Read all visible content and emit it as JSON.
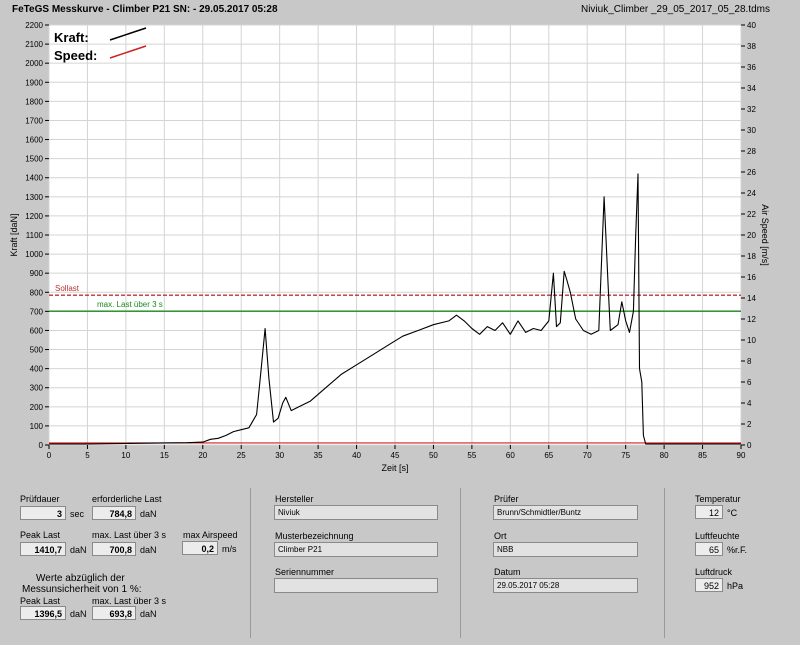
{
  "header": {
    "title": "FeTeGS Messkurve - Climber P21   SN:   - 29.05.2017 05:28",
    "file": "Niviuk_Climber _29_05_2017_05_28.tdms"
  },
  "chart_data": {
    "type": "line",
    "xlabel": "Zeit [s]",
    "ylabel": "Kraft [daN]",
    "y2label": "Air Speed [m/s]",
    "xlim": [
      0,
      90
    ],
    "ylim": [
      0,
      2200
    ],
    "y2lim": [
      0,
      40
    ],
    "xticks": [
      0,
      5,
      10,
      15,
      20,
      25,
      30,
      35,
      40,
      45,
      50,
      55,
      60,
      65,
      70,
      75,
      80,
      85,
      90
    ],
    "yticks": [
      0,
      100,
      200,
      300,
      400,
      500,
      600,
      700,
      800,
      900,
      1000,
      1100,
      1200,
      1300,
      1400,
      1500,
      1600,
      1700,
      1800,
      1900,
      2000,
      2100,
      2200
    ],
    "y2ticks": [
      0,
      2,
      4,
      6,
      8,
      10,
      12,
      14,
      16,
      18,
      20,
      22,
      24,
      26,
      28,
      30,
      32,
      34,
      36,
      38,
      40
    ],
    "grid": true,
    "legend": {
      "position": "top-left",
      "items": [
        {
          "name": "Kraft:",
          "color": "#000000"
        },
        {
          "name": "Speed:",
          "color": "#d02020"
        }
      ]
    },
    "reference_lines": [
      {
        "name": "Sollast",
        "value": 784.8,
        "color": "#c03030",
        "style": "dashed"
      },
      {
        "name": "max. Last über  3 s",
        "value": 700.8,
        "color": "#1a8a1a",
        "style": "solid"
      }
    ],
    "series": [
      {
        "name": "Kraft",
        "color": "#000000",
        "points": [
          [
            0,
            5
          ],
          [
            5,
            5
          ],
          [
            10,
            8
          ],
          [
            14,
            10
          ],
          [
            18,
            12
          ],
          [
            20,
            15
          ],
          [
            21,
            30
          ],
          [
            22,
            35
          ],
          [
            23,
            50
          ],
          [
            24,
            70
          ],
          [
            25,
            80
          ],
          [
            26,
            90
          ],
          [
            27,
            160
          ],
          [
            27.6,
            400
          ],
          [
            28.1,
            610
          ],
          [
            28.6,
            350
          ],
          [
            29.2,
            120
          ],
          [
            29.8,
            140
          ],
          [
            30.4,
            220
          ],
          [
            30.8,
            250
          ],
          [
            31.5,
            180
          ],
          [
            32.5,
            200
          ],
          [
            34,
            230
          ],
          [
            36,
            300
          ],
          [
            38,
            370
          ],
          [
            40,
            420
          ],
          [
            42,
            470
          ],
          [
            44,
            520
          ],
          [
            46,
            570
          ],
          [
            48,
            600
          ],
          [
            50,
            630
          ],
          [
            52,
            650
          ],
          [
            53,
            680
          ],
          [
            54,
            650
          ],
          [
            55,
            610
          ],
          [
            56,
            580
          ],
          [
            57,
            620
          ],
          [
            58,
            600
          ],
          [
            59,
            640
          ],
          [
            60,
            580
          ],
          [
            61,
            650
          ],
          [
            62,
            590
          ],
          [
            63,
            610
          ],
          [
            64,
            600
          ],
          [
            65,
            650
          ],
          [
            65.6,
            900
          ],
          [
            66,
            620
          ],
          [
            66.5,
            640
          ],
          [
            67,
            910
          ],
          [
            67.3,
            870
          ],
          [
            67.8,
            800
          ],
          [
            68.5,
            660
          ],
          [
            69.5,
            600
          ],
          [
            70.5,
            580
          ],
          [
            71.5,
            600
          ],
          [
            72.2,
            1300
          ],
          [
            72.7,
            850
          ],
          [
            73,
            600
          ],
          [
            74,
            630
          ],
          [
            74.5,
            750
          ],
          [
            75,
            650
          ],
          [
            75.5,
            590
          ],
          [
            76,
            700
          ],
          [
            76.3,
            1100
          ],
          [
            76.6,
            1420
          ],
          [
            76.8,
            400
          ],
          [
            77.1,
            330
          ],
          [
            77.3,
            50
          ],
          [
            77.6,
            5
          ],
          [
            80,
            5
          ],
          [
            90,
            5
          ]
        ]
      },
      {
        "name": "Speed",
        "color": "#d02020",
        "points": [
          [
            0,
            0.2
          ],
          [
            90,
            0.2
          ]
        ]
      }
    ]
  },
  "panel": {
    "pruefdauer_label": "Prüfdauer",
    "pruefdauer_value": "3",
    "pruefdauer_unit": "sec",
    "erf_last_label": "erforderliche Last",
    "erf_last_value": "784,8",
    "erf_last_unit": "daN",
    "peak_label": "Peak Last",
    "peak_value": "1410,7",
    "peak_unit": "daN",
    "maxlast_label": "max. Last über  3 s",
    "maxlast_value": "700,8",
    "maxlast_unit": "daN",
    "airspeed_label": "max Airspeed",
    "airspeed_value": "0,2",
    "airspeed_unit": "m/s",
    "note_line1": "Werte abzüglich der",
    "note_line2": "Messunsicherheit von 1   %:",
    "peak2_label": "Peak Last",
    "peak2_value": "1396,5",
    "peak2_unit": "daN",
    "maxlast2_label": "max. Last über  3 s",
    "maxlast2_value": "693,8",
    "maxlast2_unit": "daN",
    "hersteller_label": "Hersteller",
    "hersteller_value": "Niviuk",
    "muster_label": "Musterbezeichnung",
    "muster_value": "Climber P21",
    "serien_label": "Seriennummer",
    "serien_value": "",
    "pruefer_label": "Prüfer",
    "pruefer_value": "Brunn/Schmidtler/Buntz",
    "ort_label": "Ort",
    "ort_value": "NBB",
    "datum_label": "Datum",
    "datum_value": "29.05.2017 05:28",
    "temp_label": "Temperatur",
    "temp_value": "12",
    "temp_unit": "°C",
    "feuchte_label": "Luftfeuchte",
    "feuchte_value": "65",
    "feuchte_unit": "%r.F.",
    "druck_label": "Luftdruck",
    "druck_value": "952",
    "druck_unit": "hPa"
  }
}
